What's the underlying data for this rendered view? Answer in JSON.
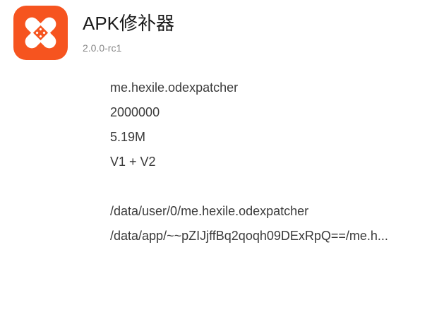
{
  "app": {
    "icon": "bandage-patch-icon",
    "icon_color": "#f6541f",
    "name": "APK修补器",
    "version": "2.0.0-rc1"
  },
  "info": {
    "package_name": "me.hexile.odexpatcher",
    "version_code": "2000000",
    "size": "5.19M",
    "signature_scheme": "V1 + V2",
    "data_dir": "/data/user/0/me.hexile.odexpatcher",
    "apk_path": "/data/app/~~pZIJjffBq2qoqh09DExRpQ==/me.h..."
  }
}
